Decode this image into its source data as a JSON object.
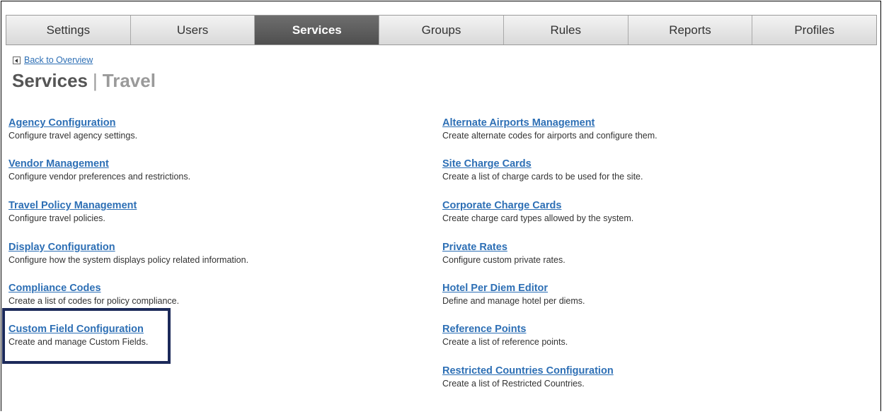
{
  "tabs": [
    {
      "label": "Settings",
      "active": false
    },
    {
      "label": "Users",
      "active": false
    },
    {
      "label": "Services",
      "active": true
    },
    {
      "label": "Groups",
      "active": false
    },
    {
      "label": "Rules",
      "active": false
    },
    {
      "label": "Reports",
      "active": false
    },
    {
      "label": "Profiles",
      "active": false
    }
  ],
  "back_link": "Back to Overview",
  "page_title": {
    "main": "Services",
    "separator": "|",
    "sub": "Travel"
  },
  "left_column": [
    {
      "title": "Agency Configuration",
      "description": "Configure travel agency settings."
    },
    {
      "title": "Vendor Management",
      "description": "Configure vendor preferences and restrictions."
    },
    {
      "title": "Travel Policy Management",
      "description": "Configure travel policies."
    },
    {
      "title": "Display Configuration",
      "description": "Configure how the system displays policy related information."
    },
    {
      "title": "Compliance Codes",
      "description": "Create a list of codes for policy compliance."
    },
    {
      "title": "Custom Field Configuration",
      "description": "Create and manage Custom Fields."
    }
  ],
  "right_column": [
    {
      "title": "Alternate Airports Management",
      "description": "Create alternate codes for airports and configure them."
    },
    {
      "title": "Site Charge Cards",
      "description": "Create a list of charge cards to be used for the site."
    },
    {
      "title": "Corporate Charge Cards",
      "description": "Create charge card types allowed by the system."
    },
    {
      "title": "Private Rates",
      "description": "Configure custom private rates."
    },
    {
      "title": "Hotel Per Diem Editor",
      "description": "Define and manage hotel per diems."
    },
    {
      "title": "Reference Points",
      "description": "Create a list of reference points."
    },
    {
      "title": "Restricted Countries Configuration",
      "description": "Create a list of Restricted Countries."
    }
  ],
  "highlight_color": "#1c2a5a",
  "link_color": "#2d6fb5"
}
